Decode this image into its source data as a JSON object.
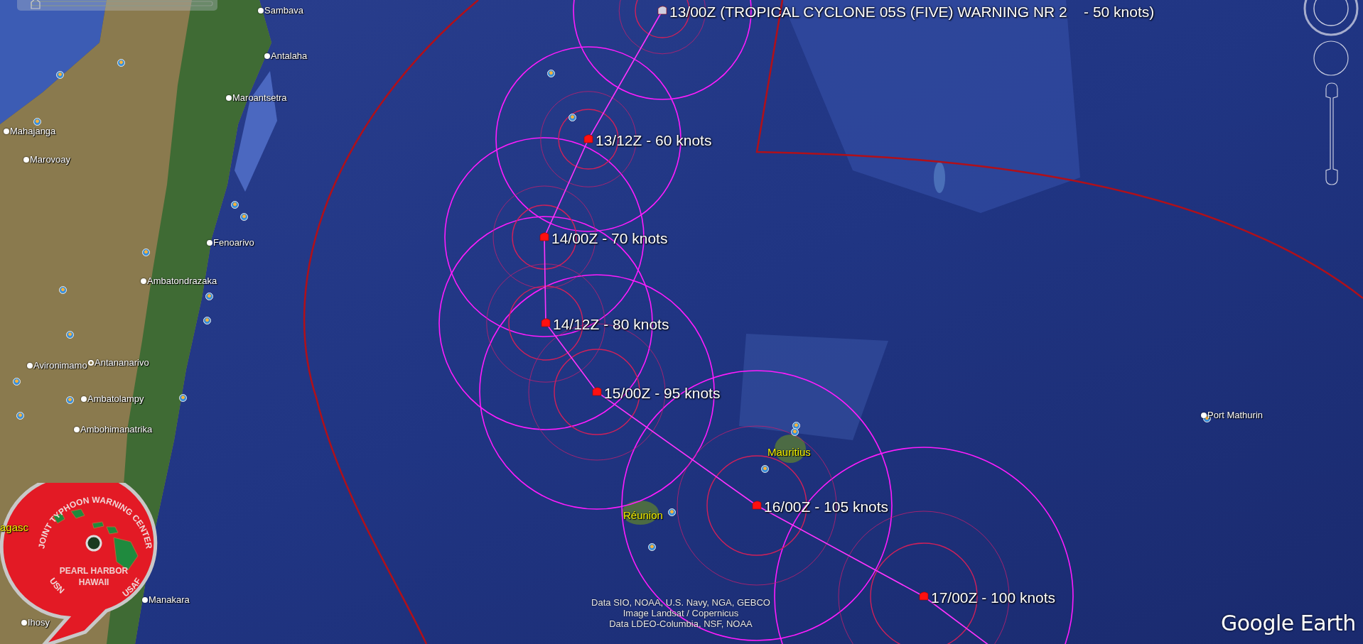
{
  "storm_track": {
    "points": [
      {
        "label": "13/00Z (TROPICAL CYCLONE 05S (FIVE) WARNING NR 2    - 50 knots)"
      },
      {
        "label": "13/12Z - 60 knots"
      },
      {
        "label": "14/00Z - 70 knots"
      },
      {
        "label": "14/12Z - 80 knots"
      },
      {
        "label": "15/00Z - 95 knots"
      },
      {
        "label": "16/00Z - 105 knots"
      },
      {
        "label": "17/00Z - 100 knots"
      }
    ]
  },
  "places": [
    {
      "name": "Sambava",
      "kind": "city"
    },
    {
      "name": "Antalaha",
      "kind": "city"
    },
    {
      "name": "Maroantsetra",
      "kind": "city"
    },
    {
      "name": "Mahajanga",
      "kind": "city"
    },
    {
      "name": "Marovoay",
      "kind": "city"
    },
    {
      "name": "Fenoarivo",
      "kind": "city"
    },
    {
      "name": "Ambatondrazaka",
      "kind": "city"
    },
    {
      "name": "Avironimamo",
      "kind": "city"
    },
    {
      "name": "Antananarivo",
      "kind": "capital"
    },
    {
      "name": "Ambatolampy",
      "kind": "city"
    },
    {
      "name": "Ambohimanatrika",
      "kind": "city"
    },
    {
      "name": "agasc",
      "kind": "region"
    },
    {
      "name": "Manakara",
      "kind": "city"
    },
    {
      "name": "Ihosy",
      "kind": "city"
    },
    {
      "name": "Mauritius",
      "kind": "region"
    },
    {
      "name": "Réunion",
      "kind": "region"
    },
    {
      "name": "Port Mathurin",
      "kind": "city"
    }
  ],
  "logo": {
    "ring_text": "JOINT TYPHOON WARNING CENTER",
    "left_text": "USN",
    "right_text": "USAF",
    "center_lines": [
      "PEARL HARBOR",
      "HAWAII"
    ]
  },
  "attribution": [
    "Data SIO, NOAA, U.S. Navy, NGA, GEBCO",
    "Image Landsat / Copernicus",
    "Data LDEO-Columbia, NSF, NOAA"
  ],
  "brand": "Google Earth"
}
